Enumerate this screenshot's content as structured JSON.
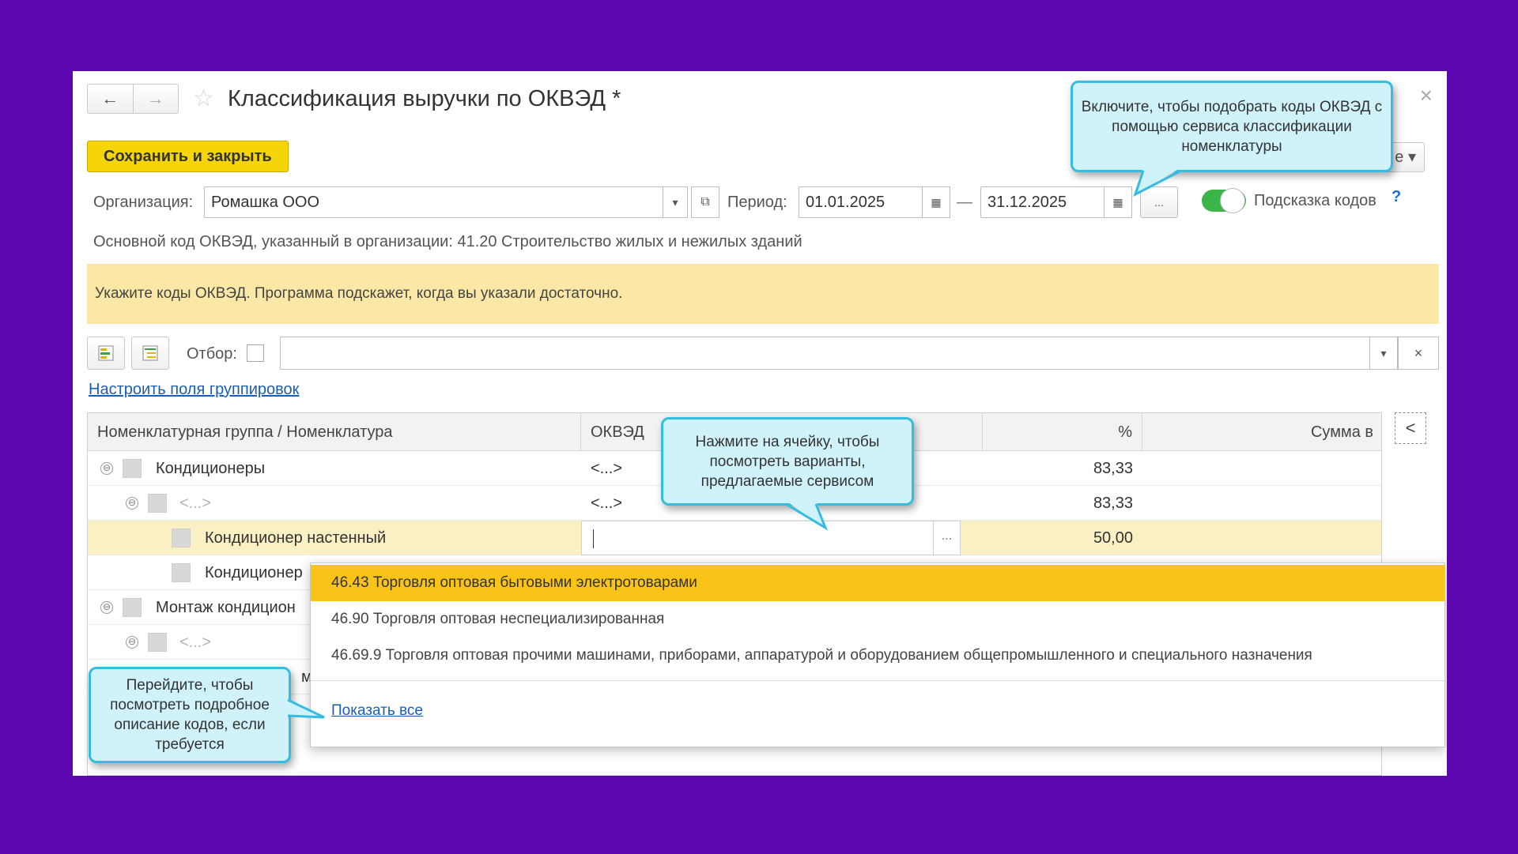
{
  "window": {
    "title": "Классификация выручки по ОКВЭД *",
    "back_icon": "←",
    "forward_icon": "→",
    "star_icon": "☆",
    "close_icon": "×"
  },
  "toolbar": {
    "save_label": "Сохранить и закрыть",
    "more_label": "е ▾"
  },
  "form": {
    "org_label": "Организация:",
    "org_value": "Ромашка ООО",
    "period_label": "Период:",
    "date_from": "01.01.2025",
    "dash": "—",
    "date_to": "31.12.2025",
    "dots": "...",
    "hint_label": "Подсказка кодов",
    "help": "?",
    "okved_info": "Основной код ОКВЭД, указанный в организации: 41.20 Строительство жилых и нежилых зданий",
    "banner": "Укажите коды ОКВЭД. Программа подскажет, когда вы указали достаточно."
  },
  "filter": {
    "label": "Отбор:",
    "configure_link": "Настроить поля группировок"
  },
  "table": {
    "headers": {
      "name": "Номенклатурная группа / Номенклатура",
      "okved": "ОКВЭД",
      "pct": "%",
      "sum": "Сумма в"
    },
    "rows": [
      {
        "name": "Кондиционеры",
        "okved": "<...>",
        "pct": "83,33"
      },
      {
        "name": "<...>",
        "okved": "<...>",
        "pct": "83,33"
      },
      {
        "name": "Кондиционер настенный",
        "okved": "",
        "pct": "50,00"
      },
      {
        "name": "Кондиционер"
      },
      {
        "name": "Монтаж кондицион"
      },
      {
        "name": "<...>"
      },
      {
        "name": "м"
      }
    ],
    "collapse_icon": "⊖",
    "side_icon": "<"
  },
  "dropdown": {
    "items": [
      "46.43 Торговля оптовая бытовыми электротоварами",
      "46.90 Торговля оптовая неспециализированная",
      "46.69.9 Торговля оптовая прочими машинами, приборами, аппаратурой и оборудованием общепромышленного и специального назначения"
    ],
    "show_all": "Показать все"
  },
  "callouts": {
    "toggle": "Включите, чтобы подобрать коды ОКВЭД с помощью сервиса классификации номенклатуры",
    "cell": "Нажмите на ячейку, чтобы посмотреть варианты, предлагаемые сервисом",
    "show_all": "Перейдите, чтобы посмотреть подробное описание кодов, если требуется"
  },
  "colors": {
    "background": "#5b06ae",
    "save_button": "#f5d50a",
    "banner": "#fbe8a6",
    "highlight": "#fac317",
    "toggle_on": "#3bb54a",
    "callout_fill": "#cff2fb",
    "callout_border": "#34bde0",
    "link": "#1a5fb4"
  }
}
